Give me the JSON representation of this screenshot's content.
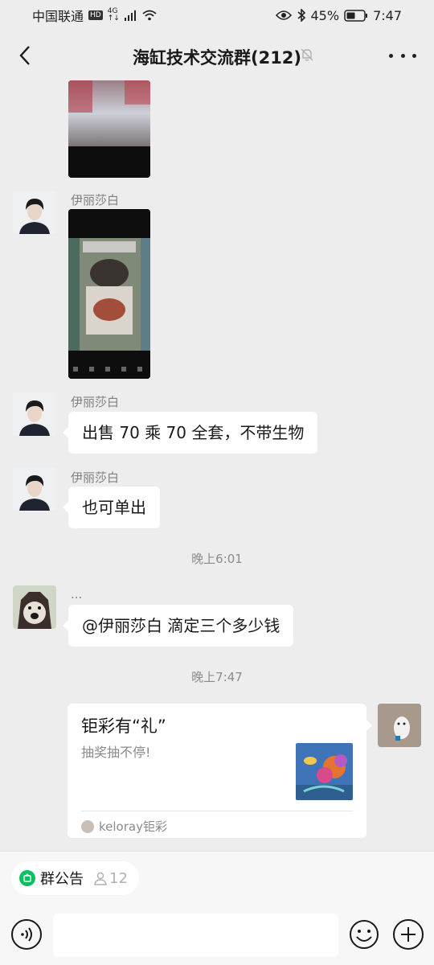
{
  "status_bar": {
    "carrier": "中国联通",
    "hd": "HD",
    "network_top": "4G",
    "network_bottom": "↑↓",
    "battery": "45%",
    "time": "7:47"
  },
  "header": {
    "title": "海缸技术交流群(212)",
    "back_icon": "chevron-left-icon",
    "mute_icon": "bell-off-icon",
    "more_icon": "more-dots-icon"
  },
  "messages": [
    {
      "type": "video",
      "sender": ""
    },
    {
      "type": "video",
      "sender": "伊丽莎白"
    },
    {
      "type": "text",
      "sender": "伊丽莎白",
      "text": "出售 70 乘 70 全套，不带生物"
    },
    {
      "type": "text",
      "sender": "伊丽莎白",
      "text": "也可单出"
    },
    {
      "type": "time",
      "text": "晚上6:01"
    },
    {
      "type": "text",
      "sender": "...",
      "text": "@伊丽莎白  滴定三个多少钱"
    },
    {
      "type": "time",
      "text": "晚上7:47"
    }
  ],
  "share_card": {
    "title": "钜彩有“礼”",
    "description": "抽奖抽不停!",
    "source": "keloray钜彩"
  },
  "bottom": {
    "announcement_label": "群公告",
    "member_count": "12",
    "input_placeholder": "",
    "voice_icon": "voice-icon",
    "emoji_icon": "emoji-icon",
    "plus_icon": "plus-icon"
  },
  "colors": {
    "background": "#ededed",
    "bubble": "#ffffff",
    "accent_green": "#07c160"
  }
}
